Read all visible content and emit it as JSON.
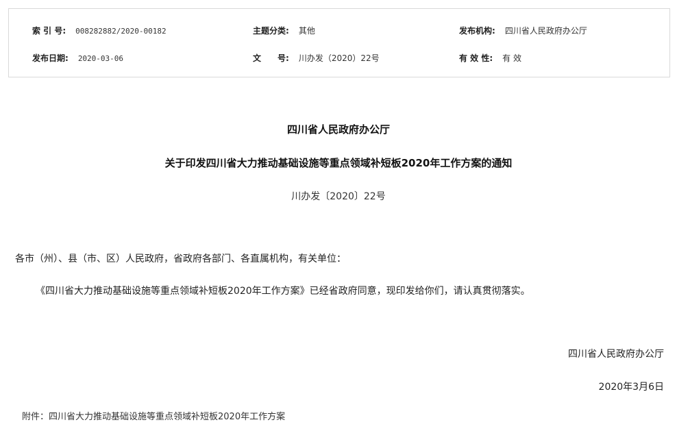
{
  "meta": {
    "index_label": "索 引 号:",
    "index_value": "008282882/2020-00182",
    "category_label": "主题分类:",
    "category_value": "其他",
    "issuer_label": "发布机构:",
    "issuer_value": "四川省人民政府办公厅",
    "date_label": "发布日期:",
    "date_value": "2020-03-06",
    "docno_label": "文　　号:",
    "docno_value": "川办发（2020）22号",
    "validity_label": "有 效 性:",
    "validity_value": "有 效"
  },
  "document": {
    "org": "四川省人民政府办公厅",
    "title": "关于印发四川省大力推动基础设施等重点领域补短板2020年工作方案的通知",
    "doc_number": "川办发〔2020〕22号",
    "salutation": "各市（州）、县（市、区）人民政府，省政府各部门、各直属机构，有关单位：",
    "body": "《四川省大力推动基础设施等重点领域补短板2020年工作方案》已经省政府同意，现印发给你们，请认真贯彻落实。",
    "signature_org": "四川省人民政府办公厅",
    "signature_date": "2020年3月6日"
  },
  "attachment": {
    "label": "附件：",
    "name": "四川省大力推动基础设施等重点领域补短板2020年工作方案"
  }
}
